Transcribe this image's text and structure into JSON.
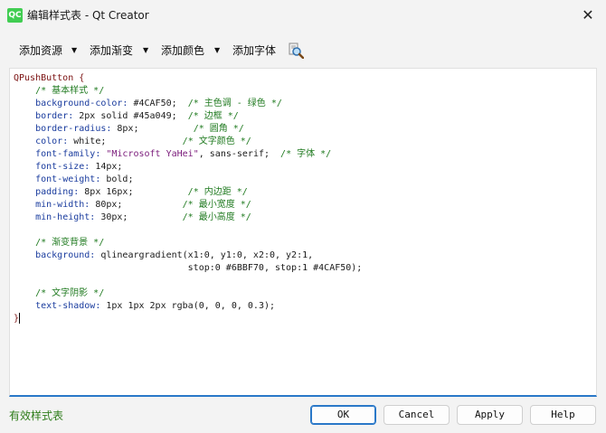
{
  "window": {
    "title": "编辑样式表 - Qt Creator",
    "app_icon_text": "QC",
    "close_glyph": "✕"
  },
  "toolbar": {
    "add_resource": "添加资源",
    "add_gradient": "添加渐变",
    "add_color": "添加颜色",
    "add_font": "添加字体",
    "arrow": "▼",
    "find_icon": "find-icon"
  },
  "editor": {
    "lines": [
      [
        [
          "sel",
          "QPushButton {"
        ]
      ],
      [
        [
          "ws",
          "    "
        ],
        [
          "com",
          "/* 基本样式 */"
        ]
      ],
      [
        [
          "ws",
          "    "
        ],
        [
          "prop",
          "background-color: "
        ],
        [
          "val",
          "#4CAF50;  "
        ],
        [
          "com",
          "/* 主色调 - 绿色 */"
        ]
      ],
      [
        [
          "ws",
          "    "
        ],
        [
          "prop",
          "border: "
        ],
        [
          "val",
          "2px solid #45a049;  "
        ],
        [
          "com",
          "/* 边框 */"
        ]
      ],
      [
        [
          "ws",
          "    "
        ],
        [
          "prop",
          "border-radius: "
        ],
        [
          "val",
          "8px;          "
        ],
        [
          "com",
          "/* 圆角 */"
        ]
      ],
      [
        [
          "ws",
          "    "
        ],
        [
          "prop",
          "color: "
        ],
        [
          "val",
          "white;              "
        ],
        [
          "com",
          "/* 文字颜色 */"
        ]
      ],
      [
        [
          "ws",
          "    "
        ],
        [
          "prop",
          "font-family: "
        ],
        [
          "str",
          "\"Microsoft YaHei\""
        ],
        [
          "val",
          ", sans-serif;  "
        ],
        [
          "com",
          "/* 字体 */"
        ]
      ],
      [
        [
          "ws",
          "    "
        ],
        [
          "prop",
          "font-size: "
        ],
        [
          "val",
          "14px;"
        ]
      ],
      [
        [
          "ws",
          "    "
        ],
        [
          "prop",
          "font-weight: "
        ],
        [
          "val",
          "bold;"
        ]
      ],
      [
        [
          "ws",
          "    "
        ],
        [
          "prop",
          "padding: "
        ],
        [
          "val",
          "8px 16px;          "
        ],
        [
          "com",
          "/* 内边距 */"
        ]
      ],
      [
        [
          "ws",
          "    "
        ],
        [
          "prop",
          "min-width: "
        ],
        [
          "val",
          "80px;           "
        ],
        [
          "com",
          "/* 最小宽度 */"
        ]
      ],
      [
        [
          "ws",
          "    "
        ],
        [
          "prop",
          "min-height: "
        ],
        [
          "val",
          "30px;          "
        ],
        [
          "com",
          "/* 最小高度 */"
        ]
      ],
      [],
      [
        [
          "ws",
          "    "
        ],
        [
          "com",
          "/* 渐变背景 */"
        ]
      ],
      [
        [
          "ws",
          "    "
        ],
        [
          "prop",
          "background: "
        ],
        [
          "val",
          "qlineargradient(x1:0, y1:0, x2:0, y2:1,"
        ]
      ],
      [
        [
          "ws",
          "                                "
        ],
        [
          "val",
          "stop:0 #6BBF70, stop:1 #4CAF50);"
        ]
      ],
      [],
      [
        [
          "ws",
          "    "
        ],
        [
          "com",
          "/* 文字阴影 */"
        ]
      ],
      [
        [
          "ws",
          "    "
        ],
        [
          "prop",
          "text-shadow: "
        ],
        [
          "val",
          "1px 1px 2px rgba(0, 0, 0, 0.3);"
        ]
      ],
      [
        [
          "sel",
          "}"
        ],
        [
          "caret",
          ""
        ]
      ]
    ]
  },
  "status": {
    "text": "有效样式表"
  },
  "buttons": {
    "ok": "OK",
    "cancel": "Cancel",
    "apply": "Apply",
    "help": "Help"
  }
}
